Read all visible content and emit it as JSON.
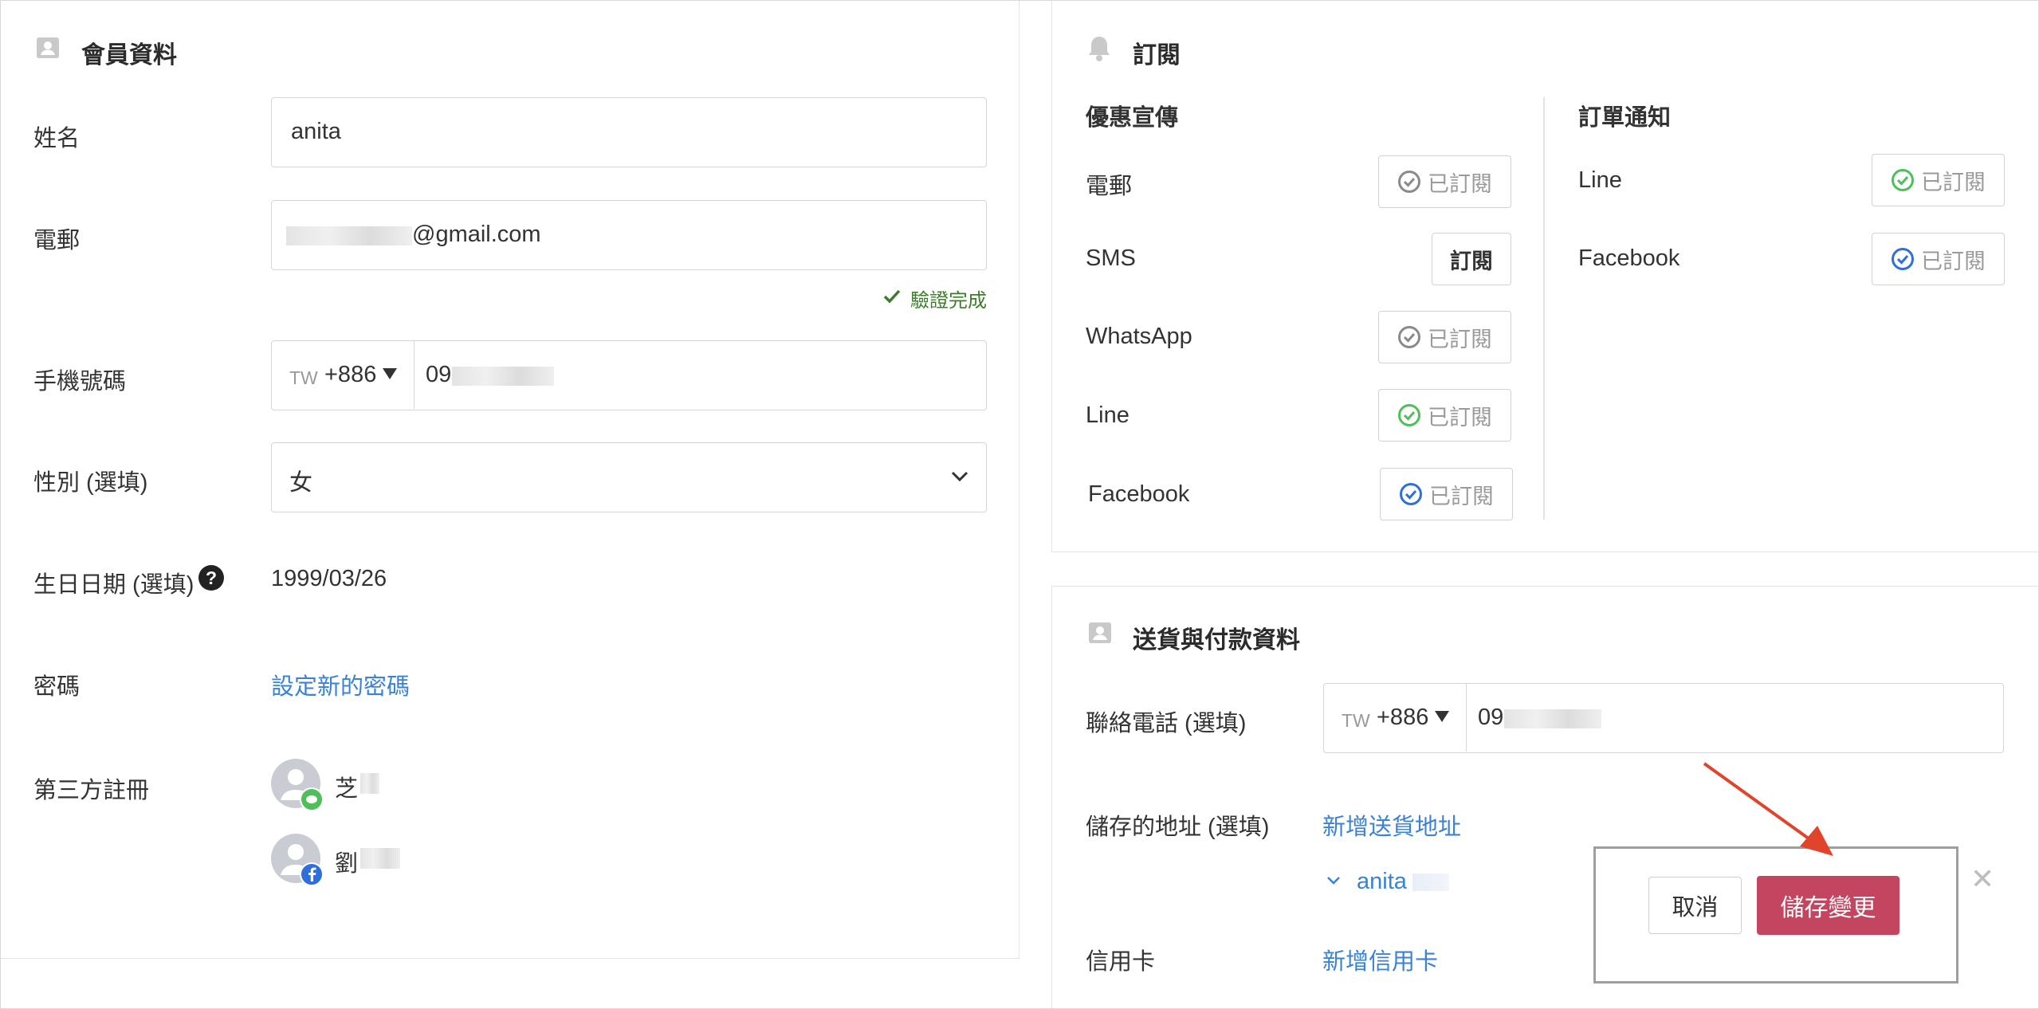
{
  "member": {
    "title": "會員資料",
    "name_label": "姓名",
    "name_value": "anita",
    "email_label": "電郵",
    "email_value": "@gmail.com",
    "verified_text": "驗證完成",
    "mobile_label": "手機號碼",
    "country_code": "TW",
    "dial_code": "+886",
    "phone_prefix": "09",
    "gender_label": "性別 (選填)",
    "gender_value": "女",
    "birthday_label": "生日日期 (選填)",
    "birthday_value": "1999/03/26",
    "password_label": "密碼",
    "password_link": "設定新的密碼",
    "third_party_label": "第三方註冊",
    "third_party": [
      {
        "name": "芝",
        "provider": "line"
      },
      {
        "name": "劉",
        "provider": "facebook"
      }
    ]
  },
  "subscription": {
    "title": "訂閱",
    "promo": {
      "heading": "優惠宣傳",
      "items": [
        {
          "label": "電郵",
          "button": "已訂閱",
          "icon": "check-circle-gray-icon"
        },
        {
          "label": "SMS",
          "button": "訂閱",
          "icon": ""
        },
        {
          "label": "WhatsApp",
          "button": "已訂閱",
          "icon": "check-circle-gray-icon"
        },
        {
          "label": "Line",
          "button": "已訂閱",
          "icon": "check-circle-green-icon"
        },
        {
          "label": "Facebook",
          "button": "已訂閱",
          "icon": "check-circle-blue-icon"
        }
      ]
    },
    "orders": {
      "heading": "訂單通知",
      "items": [
        {
          "label": "Line",
          "button": "已訂閱",
          "icon": "check-circle-green-icon"
        },
        {
          "label": "Facebook",
          "button": "已訂閱",
          "icon": "check-circle-blue-icon"
        }
      ]
    }
  },
  "shipping": {
    "title": "送貨與付款資料",
    "phone_label": "聯絡電話 (選填)",
    "country_code": "TW",
    "dial_code": "+886",
    "phone_prefix": "09",
    "address_label": "儲存的地址 (選填)",
    "add_address_link": "新增送貨地址",
    "address_name": "anita",
    "card_label": "信用卡",
    "add_card_link": "新增信用卡"
  },
  "actions": {
    "cancel": "取消",
    "save": "儲存變更"
  },
  "colors": {
    "link": "#3a82d6",
    "save_button": "#c44560",
    "verified": "#3d7c2a",
    "arrow": "#e0452c",
    "line_green": "#4fbf5a",
    "facebook_blue": "#2f6fdc"
  }
}
